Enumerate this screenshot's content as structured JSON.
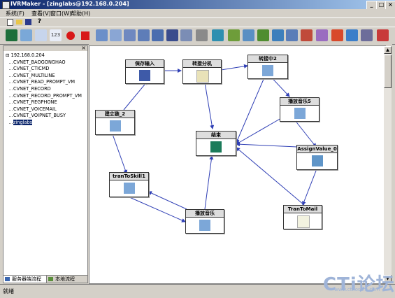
{
  "window": {
    "title": "IVRMaker - [zinglabs@192.168.0.204]"
  },
  "menu": [
    {
      "label": "系统(F)"
    },
    {
      "label": "查看(V)"
    },
    {
      "label": "窗口(W)"
    },
    {
      "label": "帮助(H)"
    }
  ],
  "toolbar1": {
    "icons": [
      "new-file-icon",
      "open-folder-icon",
      "save-icon",
      "help-icon"
    ]
  },
  "toolbar2": {
    "icons": [
      "connect-icon",
      "switch-icon",
      "variable-icon",
      "number-icon",
      "record-icon",
      "stop-icon",
      "component-icon",
      "component-icon",
      "component-icon",
      "component-icon",
      "component-icon",
      "component-icon",
      "component-icon",
      "component-icon",
      "component-icon",
      "component-icon",
      "component-icon",
      "component-icon",
      "component-icon",
      "component-icon",
      "component-icon",
      "component-icon",
      "component-icon",
      "component-icon",
      "component-icon",
      "component-icon",
      "component-icon",
      "component-icon",
      "component-icon"
    ]
  },
  "tree": {
    "root": "192.168.0.204",
    "items": [
      "CVNET_BAOGONGHAO",
      "CVNET_CTICMD",
      "CVNET_MULTILINE",
      "CVNET_READ_PROMPT_VM",
      "CVNET_RECORD",
      "CVNET_RECORD_PROMPT_VM",
      "CVNET_REGPHONE",
      "CVNET_VOICEMAIL",
      "CVNET_VOIPNET_BUSY",
      "zinglabs"
    ]
  },
  "left_tabs": [
    "服务器端流程",
    "本地流程"
  ],
  "flow": {
    "nodes": [
      {
        "id": "save-input",
        "title": "保存输入"
      },
      {
        "id": "transfer-ext",
        "title": "转接分机"
      },
      {
        "id": "transferring2",
        "title": "转接中2"
      },
      {
        "id": "play-music5",
        "title": "播放音乐5"
      },
      {
        "id": "establish-link2",
        "title": "建立链_2"
      },
      {
        "id": "end",
        "title": "结束"
      },
      {
        "id": "assign-value0",
        "title": "AssignValue_0"
      },
      {
        "id": "tran-to-skill",
        "title": "tranToSkill1"
      },
      {
        "id": "play-music",
        "title": "播放音乐"
      },
      {
        "id": "tran-to-mail",
        "title": "TranToMail"
      }
    ]
  },
  "status": {
    "text": "就绪"
  },
  "watermark": {
    "text": "CTi论坛",
    "url": "www.ctiforum.com"
  },
  "colors": {
    "title_start": "#0a246a",
    "title_end": "#a6caf0",
    "edge": "#2f3fb5",
    "selected": "#0a246a"
  }
}
